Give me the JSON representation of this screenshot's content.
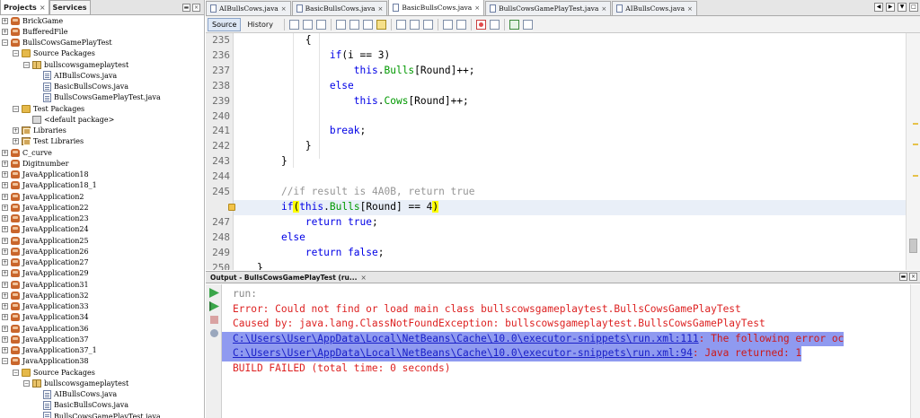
{
  "left_panel": {
    "tabs": [
      {
        "label": "Projects",
        "close": "×"
      },
      {
        "label": "Services",
        "close": ""
      }
    ],
    "tools": {
      "minimize": "▬",
      "close": "×"
    },
    "tree": [
      {
        "label": "BrickGame",
        "toggle": "+",
        "icon": "project",
        "indent": 0
      },
      {
        "label": "BufferedFile",
        "toggle": "+",
        "icon": "project",
        "indent": 0
      },
      {
        "label": "BullsCowsGamePlayTest",
        "toggle": "−",
        "icon": "project",
        "indent": 0
      },
      {
        "label": "Source Packages",
        "toggle": "−",
        "icon": "folder",
        "indent": 1
      },
      {
        "label": "bullscowsgameplaytest",
        "toggle": "−",
        "icon": "pkg",
        "indent": 2
      },
      {
        "label": "AIBullsCows.java",
        "toggle": "",
        "icon": "java",
        "indent": 3
      },
      {
        "label": "BasicBullsCows.java",
        "toggle": "",
        "icon": "java",
        "indent": 3
      },
      {
        "label": "BullsCowsGamePlayTest.java",
        "toggle": "",
        "icon": "java",
        "indent": 3
      },
      {
        "label": "Test Packages",
        "toggle": "−",
        "icon": "folder",
        "indent": 1
      },
      {
        "label": "<default package>",
        "toggle": "",
        "icon": "pkg-empty",
        "indent": 2
      },
      {
        "label": "Libraries",
        "toggle": "+",
        "icon": "lib",
        "indent": 1
      },
      {
        "label": "Test Libraries",
        "toggle": "+",
        "icon": "lib",
        "indent": 1
      },
      {
        "label": "C_curve",
        "toggle": "+",
        "icon": "project",
        "indent": 0
      },
      {
        "label": "Digitnumber",
        "toggle": "+",
        "icon": "project",
        "indent": 0
      },
      {
        "label": "JavaApplication18",
        "toggle": "+",
        "icon": "project",
        "indent": 0
      },
      {
        "label": "JavaApplication18_1",
        "toggle": "+",
        "icon": "project",
        "indent": 0
      },
      {
        "label": "JavaApplication2",
        "toggle": "+",
        "icon": "project",
        "indent": 0
      },
      {
        "label": "JavaApplication22",
        "toggle": "+",
        "icon": "project",
        "indent": 0
      },
      {
        "label": "JavaApplication23",
        "toggle": "+",
        "icon": "project",
        "indent": 0
      },
      {
        "label": "JavaApplication24",
        "toggle": "+",
        "icon": "project",
        "indent": 0
      },
      {
        "label": "JavaApplication25",
        "toggle": "+",
        "icon": "project",
        "indent": 0
      },
      {
        "label": "JavaApplication26",
        "toggle": "+",
        "icon": "project",
        "indent": 0
      },
      {
        "label": "JavaApplication27",
        "toggle": "+",
        "icon": "project",
        "indent": 0
      },
      {
        "label": "JavaApplication29",
        "toggle": "+",
        "icon": "project",
        "indent": 0
      },
      {
        "label": "JavaApplication31",
        "toggle": "+",
        "icon": "project",
        "indent": 0
      },
      {
        "label": "JavaApplication32",
        "toggle": "+",
        "icon": "project",
        "indent": 0
      },
      {
        "label": "JavaApplication33",
        "toggle": "+",
        "icon": "project",
        "indent": 0
      },
      {
        "label": "JavaApplication34",
        "toggle": "+",
        "icon": "project",
        "indent": 0
      },
      {
        "label": "JavaApplication36",
        "toggle": "+",
        "icon": "project",
        "indent": 0
      },
      {
        "label": "JavaApplication37",
        "toggle": "+",
        "icon": "project",
        "indent": 0
      },
      {
        "label": "JavaApplication37_1",
        "toggle": "+",
        "icon": "project",
        "indent": 0
      },
      {
        "label": "JavaApplication38",
        "toggle": "−",
        "icon": "project",
        "indent": 0
      },
      {
        "label": "Source Packages",
        "toggle": "−",
        "icon": "folder",
        "indent": 1
      },
      {
        "label": "bullscowsgameplaytest",
        "toggle": "−",
        "icon": "pkg",
        "indent": 2
      },
      {
        "label": "AIBullsCows.java",
        "toggle": "",
        "icon": "java",
        "indent": 3
      },
      {
        "label": "BasicBullsCows.java",
        "toggle": "",
        "icon": "java",
        "indent": 3
      },
      {
        "label": "BullsCowsGamePlayTest.java",
        "toggle": "",
        "icon": "java",
        "indent": 3
      }
    ]
  },
  "editor_tabs": [
    {
      "label": "AIBullsCows.java",
      "close": "×",
      "active": false
    },
    {
      "label": "BasicBullsCows.java",
      "close": "×",
      "active": false
    },
    {
      "label": "BasicBullsCows.java",
      "close": "×",
      "active": true
    },
    {
      "label": "BullsCowsGamePlayTest.java",
      "close": "×",
      "active": false
    },
    {
      "label": "AIBullsCows.java",
      "close": "×",
      "active": false
    }
  ],
  "editor_tab_tools": {
    "left": "◀",
    "right": "▶",
    "list": "▼",
    "max": "□"
  },
  "editor_toolbar": {
    "source_label": "Source",
    "history_label": "History"
  },
  "code_lines": [
    {
      "num": "235",
      "segs": [
        {
          "t": "        {",
          "c": ""
        }
      ]
    },
    {
      "num": "236",
      "segs": [
        {
          "t": "            ",
          "c": ""
        },
        {
          "t": "if",
          "c": "kw"
        },
        {
          "t": "(i == 3)",
          "c": ""
        }
      ]
    },
    {
      "num": "237",
      "segs": [
        {
          "t": "                ",
          "c": ""
        },
        {
          "t": "this",
          "c": "kw"
        },
        {
          "t": ".",
          "c": ""
        },
        {
          "t": "Bulls",
          "c": "fd"
        },
        {
          "t": "[Round]++;",
          "c": ""
        }
      ]
    },
    {
      "num": "238",
      "segs": [
        {
          "t": "            ",
          "c": ""
        },
        {
          "t": "else",
          "c": "kw"
        }
      ]
    },
    {
      "num": "239",
      "segs": [
        {
          "t": "                ",
          "c": ""
        },
        {
          "t": "this",
          "c": "kw"
        },
        {
          "t": ".",
          "c": ""
        },
        {
          "t": "Cows",
          "c": "fd"
        },
        {
          "t": "[Round]++;",
          "c": ""
        }
      ]
    },
    {
      "num": "240",
      "segs": [
        {
          "t": "",
          "c": ""
        }
      ]
    },
    {
      "num": "241",
      "segs": [
        {
          "t": "            ",
          "c": ""
        },
        {
          "t": "break",
          "c": "kw"
        },
        {
          "t": ";",
          "c": ""
        }
      ]
    },
    {
      "num": "242",
      "segs": [
        {
          "t": "        }",
          "c": ""
        }
      ]
    },
    {
      "num": "243",
      "segs": [
        {
          "t": "    }",
          "c": ""
        }
      ]
    },
    {
      "num": "244",
      "segs": [
        {
          "t": "",
          "c": ""
        }
      ]
    },
    {
      "num": "245",
      "segs": [
        {
          "t": "    ",
          "c": ""
        },
        {
          "t": "//if result is 4A0B, return true",
          "c": "cm"
        }
      ]
    },
    {
      "num": "",
      "segs": [
        {
          "t": "    ",
          "c": ""
        },
        {
          "t": "if",
          "c": "kw"
        },
        {
          "t": "(",
          "c": "bm"
        },
        {
          "t": "this",
          "c": "kw"
        },
        {
          "t": ".",
          "c": ""
        },
        {
          "t": "Bulls",
          "c": "fd"
        },
        {
          "t": "[Round] == 4",
          "c": ""
        },
        {
          "t": ")",
          "c": "bm"
        }
      ],
      "highlight": true,
      "warning": true
    },
    {
      "num": "247",
      "segs": [
        {
          "t": "        ",
          "c": ""
        },
        {
          "t": "return",
          "c": "kw"
        },
        {
          "t": " ",
          "c": ""
        },
        {
          "t": "true",
          "c": "kw"
        },
        {
          "t": ";",
          "c": ""
        }
      ]
    },
    {
      "num": "248",
      "segs": [
        {
          "t": "    ",
          "c": ""
        },
        {
          "t": "else",
          "c": "kw"
        }
      ]
    },
    {
      "num": "249",
      "segs": [
        {
          "t": "        ",
          "c": ""
        },
        {
          "t": "return",
          "c": "kw"
        },
        {
          "t": " ",
          "c": ""
        },
        {
          "t": "false",
          "c": "kw"
        },
        {
          "t": ";",
          "c": ""
        }
      ]
    },
    {
      "num": "250",
      "segs": [
        {
          "t": "}",
          "c": ""
        }
      ]
    }
  ],
  "output": {
    "title": "Output - BullsCowsGamePlayTest (ru...",
    "close": "×",
    "tools": {
      "minimize": "▬",
      "close": "×"
    },
    "lines": [
      {
        "t": "run:",
        "kind": "run"
      },
      {
        "t": "Error: Could not find or load main class bullscowsgameplaytest.BullsCowsGamePlayTest",
        "kind": "err"
      },
      {
        "t": "Caused by: java.lang.ClassNotFoundException: bullscowsgameplaytest.BullsCowsGamePlayTest",
        "kind": "err"
      },
      {
        "link": "C:\\Users\\User\\AppData\\Local\\NetBeans\\Cache\\10.0\\executor-snippets\\run.xml:111",
        "rest": ": The following error oc",
        "kind": "sel"
      },
      {
        "link": "C:\\Users\\User\\AppData\\Local\\NetBeans\\Cache\\10.0\\executor-snippets\\run.xml:94",
        "rest": ": Java returned: 1",
        "kind": "sel"
      },
      {
        "t": "BUILD FAILED (total time: 0 seconds)",
        "kind": "err"
      }
    ]
  },
  "colors": {
    "keyword": "#0000e6",
    "comment": "#969696",
    "field": "#009900",
    "error_text": "#dd2222",
    "selection": "#8f9af0",
    "brace_match": "#ffff00"
  }
}
